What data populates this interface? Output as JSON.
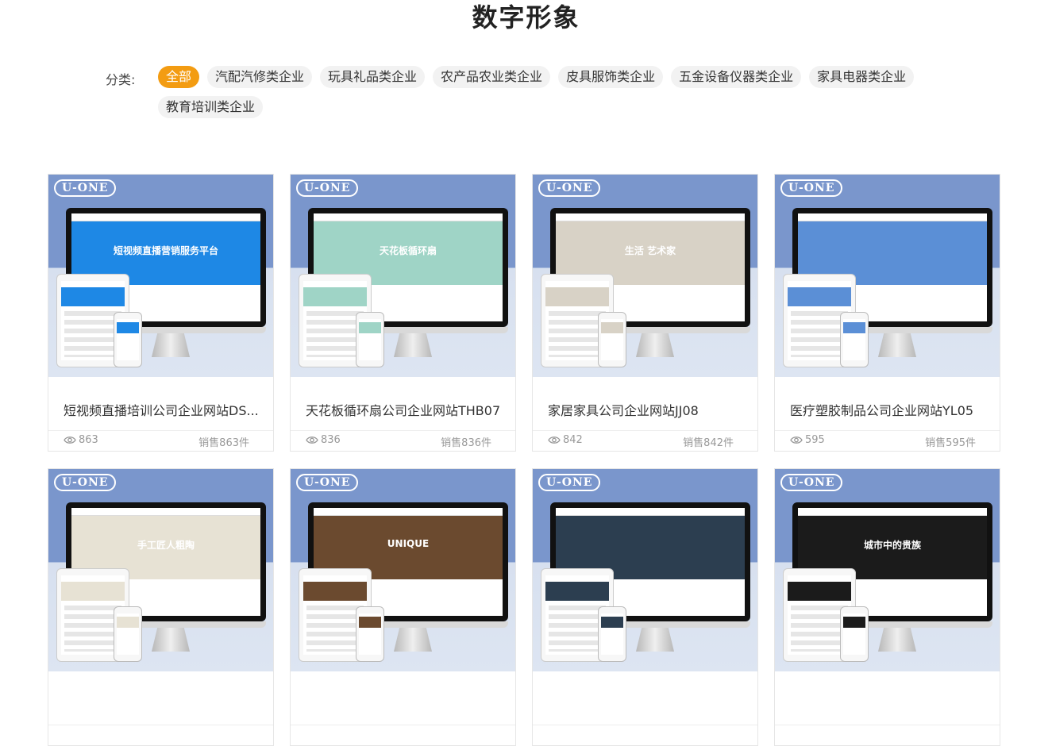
{
  "page": {
    "title": "数字形象"
  },
  "filter": {
    "label": "分类:",
    "chips": [
      {
        "label": "全部",
        "active": true
      },
      {
        "label": "汽配汽修类企业",
        "active": false
      },
      {
        "label": "玩具礼品类企业",
        "active": false
      },
      {
        "label": "农产品农业类企业",
        "active": false
      },
      {
        "label": "皮具服饰类企业",
        "active": false
      },
      {
        "label": "五金设备仪器类企业",
        "active": false
      },
      {
        "label": "家具电器类企业",
        "active": false
      },
      {
        "label": "教育培训类企业",
        "active": false
      }
    ]
  },
  "products": [
    {
      "brand": "U-ONE",
      "screen_text": "短视频直播营销服务平台",
      "hero_color": "#1e88e5",
      "title": "短视频直播培训公司企业网站DS...",
      "views": "863",
      "sales": "销售863件"
    },
    {
      "brand": "U-ONE",
      "screen_text": "天花板循环扇",
      "hero_color": "#9fd4c6",
      "title": "天花板循环扇公司企业网站THB07",
      "views": "836",
      "sales": "销售836件"
    },
    {
      "brand": "U-ONE",
      "screen_text": "生活 艺术家",
      "hero_color": "#d8d2c6",
      "title": "家居家具公司企业网站JJ08",
      "views": "842",
      "sales": "销售842件"
    },
    {
      "brand": "U-ONE",
      "screen_text": "",
      "hero_color": "#5b8fd6",
      "title": "医疗塑胶制品公司企业网站YL05",
      "views": "595",
      "sales": "销售595件"
    },
    {
      "brand": "U-ONE",
      "screen_text": "手工匠人粗陶",
      "hero_color": "#e7e2d4",
      "title": "",
      "views": "",
      "sales": ""
    },
    {
      "brand": "U-ONE",
      "screen_text": "UNIQUE",
      "hero_color": "#6b4a2f",
      "title": "",
      "views": "",
      "sales": ""
    },
    {
      "brand": "U-ONE",
      "screen_text": "",
      "hero_color": "#2c3e50",
      "title": "",
      "views": "",
      "sales": ""
    },
    {
      "brand": "U-ONE",
      "screen_text": "城市中的贵族",
      "hero_color": "#1b1b1b",
      "title": "",
      "views": "",
      "sales": ""
    }
  ],
  "colors": {
    "accent": "#f39c12",
    "thumb_bg": "#7a96cc"
  },
  "icons": {
    "views": "eye-icon"
  }
}
